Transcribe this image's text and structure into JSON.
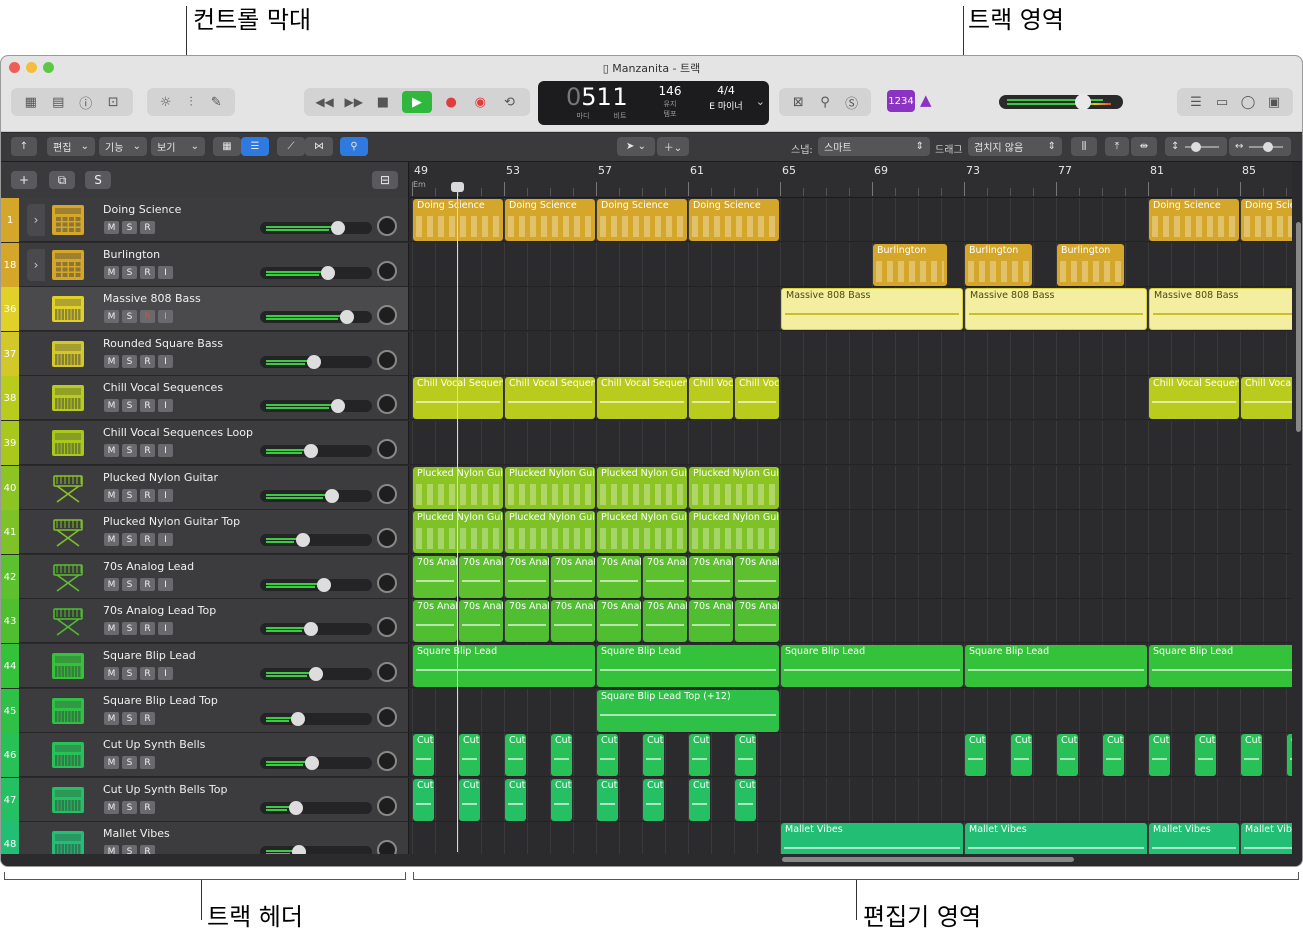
{
  "callouts": {
    "control_bar": "컨트롤 막대",
    "tracks_area": "트랙 영역",
    "track_header": "트랙 헤더",
    "editor_area": "편집기 영역"
  },
  "window": {
    "title": "Manzanita - 트랙"
  },
  "lcd": {
    "bar": "51",
    "bar_prefix": "0",
    "beat": "1",
    "bar_label": "마디",
    "beat_label": "비트",
    "tempo": "146",
    "tempo_sub": "유지",
    "tempo_label": "템포",
    "time_sig": "4/4",
    "key": "E 마이너"
  },
  "smart_tempo_badge": "1234",
  "control_bar": {
    "edit": "편집",
    "functions": "기능",
    "view": "보기",
    "snap_label": "스냅:",
    "snap_value": "스마트",
    "drag_label": "드래그",
    "drag_value": "겹치지 않음"
  },
  "header_buttons": {
    "add": "+",
    "duplicate": "⧉",
    "solo": "S"
  },
  "ruler": {
    "bars": [
      "49",
      "53",
      "57",
      "61",
      "65",
      "69",
      "73",
      "77",
      "81",
      "85"
    ],
    "em": "Em"
  },
  "button_labels": {
    "m": "M",
    "s": "S",
    "r": "R",
    "i": "I"
  },
  "tracks": [
    {
      "num": "1",
      "name": "Doing Science",
      "color": "#d4a62a",
      "type": "drum",
      "folder": true,
      "has_i": false,
      "fader": 0.72,
      "regions": [
        {
          "name": "Doing Science",
          "s": 49,
          "e": 53
        },
        {
          "name": "Doing Science",
          "s": 53,
          "e": 57
        },
        {
          "name": "Doing Science",
          "s": 57,
          "e": 61
        },
        {
          "name": "Doing Science",
          "s": 61,
          "e": 65
        },
        {
          "name": "Doing Science",
          "s": 81,
          "e": 85
        },
        {
          "name": "Doing Science",
          "s": 85,
          "e": 89
        }
      ]
    },
    {
      "num": "18",
      "name": "Burlington",
      "color": "#d4a62a",
      "type": "drum",
      "folder": true,
      "has_i": true,
      "fader": 0.62,
      "regions": [
        {
          "name": "Burlington",
          "s": 69,
          "e": 72.3
        },
        {
          "name": "Burlington",
          "s": 73,
          "e": 76
        },
        {
          "name": "Burlington",
          "s": 77,
          "e": 80
        }
      ]
    },
    {
      "num": "36",
      "name": "Massive 808 Bass",
      "color": "#e0d02a",
      "type": "synth",
      "folder": false,
      "has_i": true,
      "fader": 0.82,
      "light": true,
      "regions": [
        {
          "name": "Massive 808 Bass",
          "s": 65,
          "e": 73
        },
        {
          "name": "Massive 808 Bass",
          "s": 73,
          "e": 81
        },
        {
          "name": "Massive 808 Bass",
          "s": 81,
          "e": 89
        }
      ]
    },
    {
      "num": "37",
      "name": "Rounded Square Bass",
      "color": "#d3c82a",
      "type": "synth",
      "folder": false,
      "has_i": true,
      "fader": 0.48,
      "regions": []
    },
    {
      "num": "38",
      "name": "Chill Vocal Sequences",
      "color": "#b9cc1e",
      "type": "synth",
      "folder": false,
      "has_i": true,
      "fader": 0.72,
      "regions": [
        {
          "name": "Chill Vocal Sequen",
          "s": 49,
          "e": 53
        },
        {
          "name": "Chill Vocal Sequen",
          "s": 53,
          "e": 57
        },
        {
          "name": "Chill Vocal Sequen",
          "s": 57,
          "e": 61
        },
        {
          "name": "Chill Voc",
          "s": 61,
          "e": 63
        },
        {
          "name": "Chill Voc",
          "s": 63,
          "e": 65
        },
        {
          "name": "Chill Vocal Sequen",
          "s": 81,
          "e": 85
        },
        {
          "name": "Chill Voca",
          "s": 85,
          "e": 89
        }
      ]
    },
    {
      "num": "39",
      "name": "Chill Vocal Sequences Loop",
      "color": "#a8c81e",
      "type": "synth",
      "folder": false,
      "has_i": true,
      "fader": 0.45,
      "regions": []
    },
    {
      "num": "40",
      "name": "Plucked Nylon Guitar",
      "color": "#8cc424",
      "type": "keys",
      "folder": false,
      "has_i": true,
      "fader": 0.66,
      "regions": [
        {
          "name": "Plucked Nylon Guit",
          "s": 49,
          "e": 53
        },
        {
          "name": "Plucked Nylon Guit",
          "s": 53,
          "e": 57
        },
        {
          "name": "Plucked Nylon Guit",
          "s": 57,
          "e": 61
        },
        {
          "name": "Plucked Nylon Gui",
          "s": 61,
          "e": 65
        }
      ]
    },
    {
      "num": "41",
      "name": "Plucked Nylon Guitar Top",
      "color": "#7ec228",
      "type": "keys",
      "folder": false,
      "has_i": true,
      "fader": 0.37,
      "regions": [
        {
          "name": "Plucked Nylon Guit",
          "s": 49,
          "e": 53
        },
        {
          "name": "Plucked Nylon Guit",
          "s": 53,
          "e": 57
        },
        {
          "name": "Plucked Nylon Guit",
          "s": 57,
          "e": 61
        },
        {
          "name": "Plucked Nylon Gui",
          "s": 61,
          "e": 65
        }
      ]
    },
    {
      "num": "42",
      "name": "70s Analog Lead",
      "color": "#5dc02e",
      "type": "keys",
      "folder": false,
      "has_i": true,
      "fader": 0.58,
      "regions": [
        {
          "name": "70s Anal",
          "s": 49,
          "e": 51
        },
        {
          "name": "70s Anal",
          "s": 51,
          "e": 53
        },
        {
          "name": "70s Anal",
          "s": 53,
          "e": 55
        },
        {
          "name": "70s Anal",
          "s": 55,
          "e": 57
        },
        {
          "name": "70s Anal",
          "s": 57,
          "e": 59
        },
        {
          "name": "70s Anal",
          "s": 59,
          "e": 61
        },
        {
          "name": "70s Anal",
          "s": 61,
          "e": 63
        },
        {
          "name": "70s Anal",
          "s": 63,
          "e": 65
        }
      ]
    },
    {
      "num": "43",
      "name": "70s Analog Lead Top",
      "color": "#4fbe30",
      "type": "keys",
      "folder": false,
      "has_i": true,
      "fader": 0.45,
      "regions": [
        {
          "name": "70s Anal",
          "s": 49,
          "e": 51
        },
        {
          "name": "70s Anal",
          "s": 51,
          "e": 53
        },
        {
          "name": "70s Anal",
          "s": 53,
          "e": 55
        },
        {
          "name": "70s Anal",
          "s": 55,
          "e": 57
        },
        {
          "name": "70s Anal",
          "s": 57,
          "e": 59
        },
        {
          "name": "70s Anal",
          "s": 59,
          "e": 61
        },
        {
          "name": "70s Anal",
          "s": 61,
          "e": 63
        },
        {
          "name": "70s Anal",
          "s": 63,
          "e": 65
        }
      ]
    },
    {
      "num": "44",
      "name": "Square Blip Lead",
      "color": "#34c23a",
      "type": "synth",
      "folder": false,
      "has_i": true,
      "fader": 0.5,
      "regions": [
        {
          "name": "Square Blip Lead",
          "s": 49,
          "e": 57
        },
        {
          "name": "Square Blip Lead",
          "s": 57,
          "e": 65
        },
        {
          "name": "Square Blip Lead",
          "s": 65,
          "e": 73
        },
        {
          "name": "Square Blip Lead",
          "s": 73,
          "e": 81
        },
        {
          "name": "Square Blip Lead",
          "s": 81,
          "e": 89
        }
      ]
    },
    {
      "num": "45",
      "name": "Square Blip Lead Top",
      "color": "#2fc048",
      "type": "synth",
      "folder": false,
      "has_i": false,
      "fader": 0.32,
      "regions": [
        {
          "name": "Square Blip Lead Top (+12)",
          "s": 57,
          "e": 65
        }
      ]
    },
    {
      "num": "46",
      "name": "Cut Up Synth Bells",
      "color": "#28c158",
      "type": "synth",
      "folder": false,
      "has_i": false,
      "fader": 0.46,
      "regions": [
        {
          "name": "Cut",
          "s": 49,
          "e": 50
        },
        {
          "name": "Cut",
          "s": 51,
          "e": 52
        },
        {
          "name": "Cut",
          "s": 53,
          "e": 54
        },
        {
          "name": "Cut",
          "s": 55,
          "e": 56
        },
        {
          "name": "Cut",
          "s": 57,
          "e": 58
        },
        {
          "name": "Cut",
          "s": 59,
          "e": 60
        },
        {
          "name": "Cut",
          "s": 61,
          "e": 62
        },
        {
          "name": "Cut",
          "s": 63,
          "e": 64
        },
        {
          "name": "Cut",
          "s": 73,
          "e": 74
        },
        {
          "name": "Cut",
          "s": 75,
          "e": 76
        },
        {
          "name": "Cut",
          "s": 77,
          "e": 78
        },
        {
          "name": "Cut",
          "s": 79,
          "e": 80
        },
        {
          "name": "Cut",
          "s": 81,
          "e": 82
        },
        {
          "name": "Cut",
          "s": 83,
          "e": 84
        },
        {
          "name": "Cut",
          "s": 85,
          "e": 86
        },
        {
          "name": "Cut",
          "s": 87,
          "e": 88
        }
      ]
    },
    {
      "num": "47",
      "name": "Cut Up Synth Bells Top",
      "color": "#25c064",
      "type": "synth",
      "folder": false,
      "has_i": false,
      "fader": 0.3,
      "regions": [
        {
          "name": "Cut",
          "s": 49,
          "e": 50
        },
        {
          "name": "Cut",
          "s": 51,
          "e": 52
        },
        {
          "name": "Cut",
          "s": 53,
          "e": 54
        },
        {
          "name": "Cut",
          "s": 55,
          "e": 56
        },
        {
          "name": "Cut",
          "s": 57,
          "e": 58
        },
        {
          "name": "Cut",
          "s": 59,
          "e": 60
        },
        {
          "name": "Cut",
          "s": 61,
          "e": 62
        },
        {
          "name": "Cut",
          "s": 63,
          "e": 64
        }
      ]
    },
    {
      "num": "48",
      "name": "Mallet Vibes",
      "color": "#22be74",
      "type": "synth",
      "folder": false,
      "has_i": false,
      "fader": 0.33,
      "regions": [
        {
          "name": "Mallet Vibes",
          "s": 65,
          "e": 73
        },
        {
          "name": "Mallet Vibes",
          "s": 73,
          "e": 81
        },
        {
          "name": "Mallet Vibes",
          "s": 81,
          "e": 85
        },
        {
          "name": "Mallet Vib",
          "s": 85,
          "e": 89
        }
      ]
    }
  ]
}
